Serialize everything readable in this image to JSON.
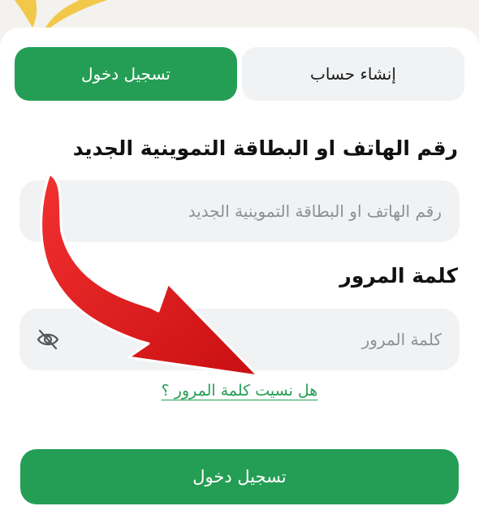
{
  "tabs": {
    "login_label": "تسجيل دخول",
    "signup_label": "إنشاء حساب",
    "active": "login"
  },
  "form": {
    "phone_label": "رقم الهاتف او البطاقة التموينية الجديد",
    "phone_placeholder": "رقم الهاتف او البطاقة التموينية الجديد",
    "password_label": "كلمة المرور",
    "password_placeholder": "كلمة المرور",
    "password_toggle_icon": "eye-off-icon",
    "forgot_label": "هل نسيت كلمة المرور ؟",
    "submit_label": "تسجيل دخول"
  },
  "annotation": {
    "icon": "red-arrow",
    "color": "#e3191c"
  },
  "colors": {
    "brand": "#259e55",
    "field_bg": "#f1f2f4",
    "logo": "#f2c84b"
  }
}
